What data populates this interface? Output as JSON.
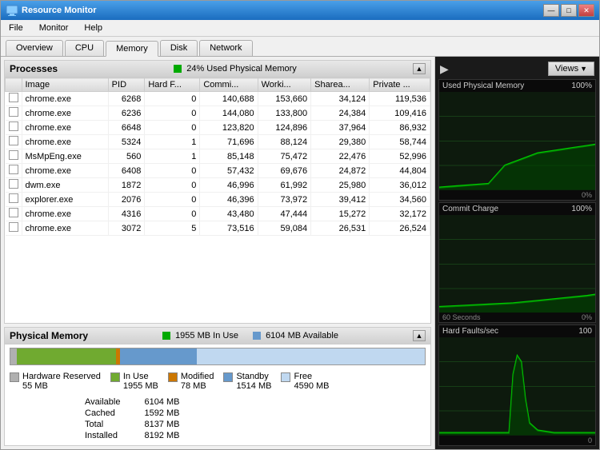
{
  "window": {
    "title": "Resource Monitor",
    "controls": {
      "minimize": "—",
      "maximize": "□",
      "close": "✕"
    }
  },
  "menu": {
    "items": [
      "File",
      "Monitor",
      "Help"
    ]
  },
  "tabs": [
    {
      "label": "Overview",
      "active": false
    },
    {
      "label": "CPU",
      "active": false
    },
    {
      "label": "Memory",
      "active": true
    },
    {
      "label": "Disk",
      "active": false
    },
    {
      "label": "Network",
      "active": false
    }
  ],
  "processes": {
    "title": "Processes",
    "summary": "24% Used Physical Memory",
    "columns": [
      "Image",
      "PID",
      "Hard F...",
      "Commi...",
      "Worki...",
      "Sharea...",
      "Private ..."
    ],
    "rows": [
      {
        "image": "chrome.exe",
        "pid": "6268",
        "hard_faults": "0",
        "commit": "140,688",
        "working": "153,660",
        "shared": "34,124",
        "private": "119,536"
      },
      {
        "image": "chrome.exe",
        "pid": "6236",
        "hard_faults": "0",
        "commit": "144,080",
        "working": "133,800",
        "shared": "24,384",
        "private": "109,416"
      },
      {
        "image": "chrome.exe",
        "pid": "6648",
        "hard_faults": "0",
        "commit": "123,820",
        "working": "124,896",
        "shared": "37,964",
        "private": "86,932"
      },
      {
        "image": "chrome.exe",
        "pid": "5324",
        "hard_faults": "1",
        "commit": "71,696",
        "working": "88,124",
        "shared": "29,380",
        "private": "58,744"
      },
      {
        "image": "MsMpEng.exe",
        "pid": "560",
        "hard_faults": "1",
        "commit": "85,148",
        "working": "75,472",
        "shared": "22,476",
        "private": "52,996"
      },
      {
        "image": "chrome.exe",
        "pid": "6408",
        "hard_faults": "0",
        "commit": "57,432",
        "working": "69,676",
        "shared": "24,872",
        "private": "44,804"
      },
      {
        "image": "dwm.exe",
        "pid": "1872",
        "hard_faults": "0",
        "commit": "46,996",
        "working": "61,992",
        "shared": "25,980",
        "private": "36,012"
      },
      {
        "image": "explorer.exe",
        "pid": "2076",
        "hard_faults": "0",
        "commit": "46,396",
        "working": "73,972",
        "shared": "39,412",
        "private": "34,560"
      },
      {
        "image": "chrome.exe",
        "pid": "4316",
        "hard_faults": "0",
        "commit": "43,480",
        "working": "47,444",
        "shared": "15,272",
        "private": "32,172"
      },
      {
        "image": "chrome.exe",
        "pid": "3072",
        "hard_faults": "5",
        "commit": "73,516",
        "working": "59,084",
        "shared": "26,531",
        "private": "26,524"
      }
    ]
  },
  "physical_memory": {
    "title": "Physical Memory",
    "in_use_label": "1955 MB In Use",
    "available_label": "6104 MB Available",
    "legend": {
      "hardware_reserved_label": "Hardware Reserved",
      "hardware_reserved_val": "55 MB",
      "in_use_label": "In Use",
      "in_use_val": "1955 MB",
      "modified_label": "Modified",
      "modified_val": "78 MB",
      "standby_label": "Standby",
      "standby_val": "1514 MB",
      "free_label": "Free",
      "free_val": "4590 MB"
    },
    "stats": {
      "available_label": "Available",
      "available_val": "6104 MB",
      "cached_label": "Cached",
      "cached_val": "1592 MB",
      "total_label": "Total",
      "total_val": "8137 MB",
      "installed_label": "Installed",
      "installed_val": "8192 MB"
    }
  },
  "right_panel": {
    "views_label": "Views",
    "charts": [
      {
        "title": "Used Physical Memory",
        "pct_left": "100%",
        "pct_right": "0%"
      },
      {
        "title": "60 Seconds",
        "sub_title": "Commit Charge",
        "pct_left": "100%",
        "pct_right": "0%"
      },
      {
        "title": "Hard Faults/sec",
        "pct_top": "100",
        "pct_bottom": "0"
      }
    ]
  }
}
